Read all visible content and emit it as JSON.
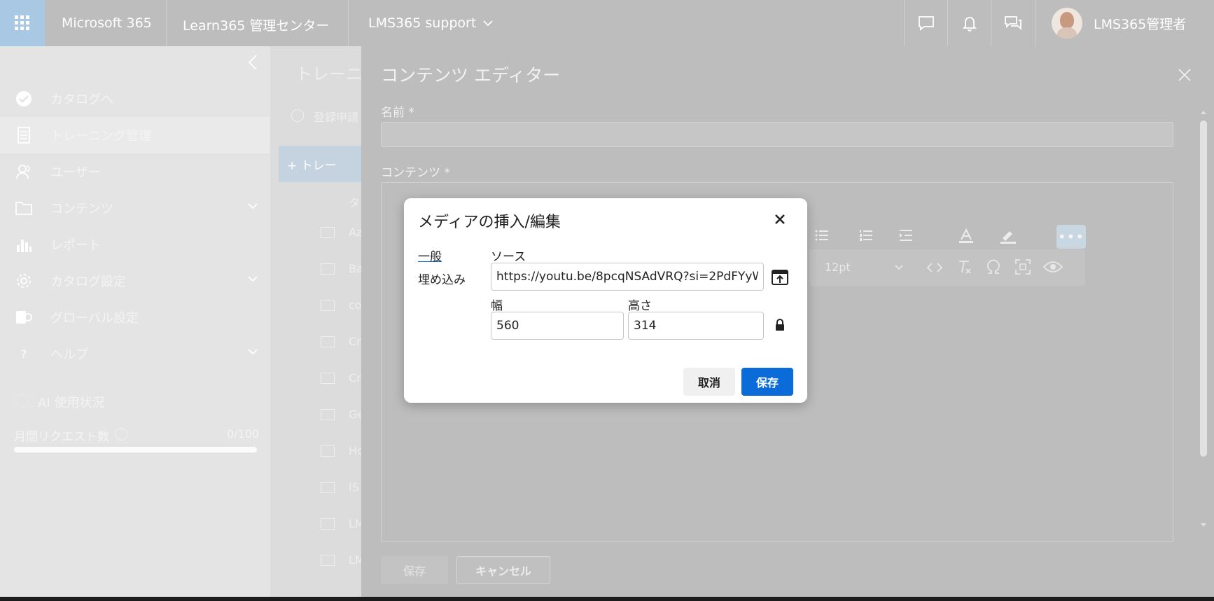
{
  "topbar": {
    "app_name": "Microsoft 365",
    "center_name": "Learn365 管理センター",
    "site_selector": "LMS365 support",
    "user_name": "LMS365管理者"
  },
  "sidebar": {
    "items": [
      {
        "label": "カタログへ",
        "icon": "check-circle-icon"
      },
      {
        "label": "トレーニング管理",
        "icon": "document-icon"
      },
      {
        "label": "ユーザー",
        "icon": "users-icon"
      },
      {
        "label": "コンテンツ",
        "icon": "folder-icon"
      },
      {
        "label": "レポート",
        "icon": "bar-chart-icon"
      },
      {
        "label": "カタログ設定",
        "icon": "gear-icon"
      },
      {
        "label": "グローバル設定",
        "icon": "settings-icon"
      },
      {
        "label": "ヘルプ",
        "icon": "question-icon"
      }
    ],
    "ai_usage_title": "AI 使用状況",
    "monthly_requests_label": "月間リクエスト数",
    "monthly_requests_value": "0/100"
  },
  "midpanel": {
    "title": "トレーニ",
    "registration_label": "登録申請",
    "add_button": "+ トレー",
    "column_header": "タ",
    "rows": [
      "Az",
      "Ba",
      "co",
      "Cr",
      "Cr",
      "Ge",
      "Ho",
      "IS",
      "LM",
      "LM"
    ]
  },
  "editor": {
    "title": "コンテンツ エディター",
    "name_label": "名前 *",
    "content_label": "コンテンツ *",
    "font_size": "12pt",
    "save_label": "保存",
    "cancel_label": "キャンセル"
  },
  "modal": {
    "title": "メディアの挿入/編集",
    "tabs": [
      "一般",
      "埋め込み"
    ],
    "source_label": "ソース",
    "source_value": "https://youtu.be/8pcqNSAdVRQ?si=2PdFYyW",
    "width_label": "幅",
    "width_value": "560",
    "height_label": "高さ",
    "height_value": "314",
    "cancel_label": "取消",
    "save_label": "保存"
  },
  "colors": {
    "accent": "#0b6bd8",
    "topbar": "#bdbdbd",
    "sidebar": "#e4e4e4"
  }
}
